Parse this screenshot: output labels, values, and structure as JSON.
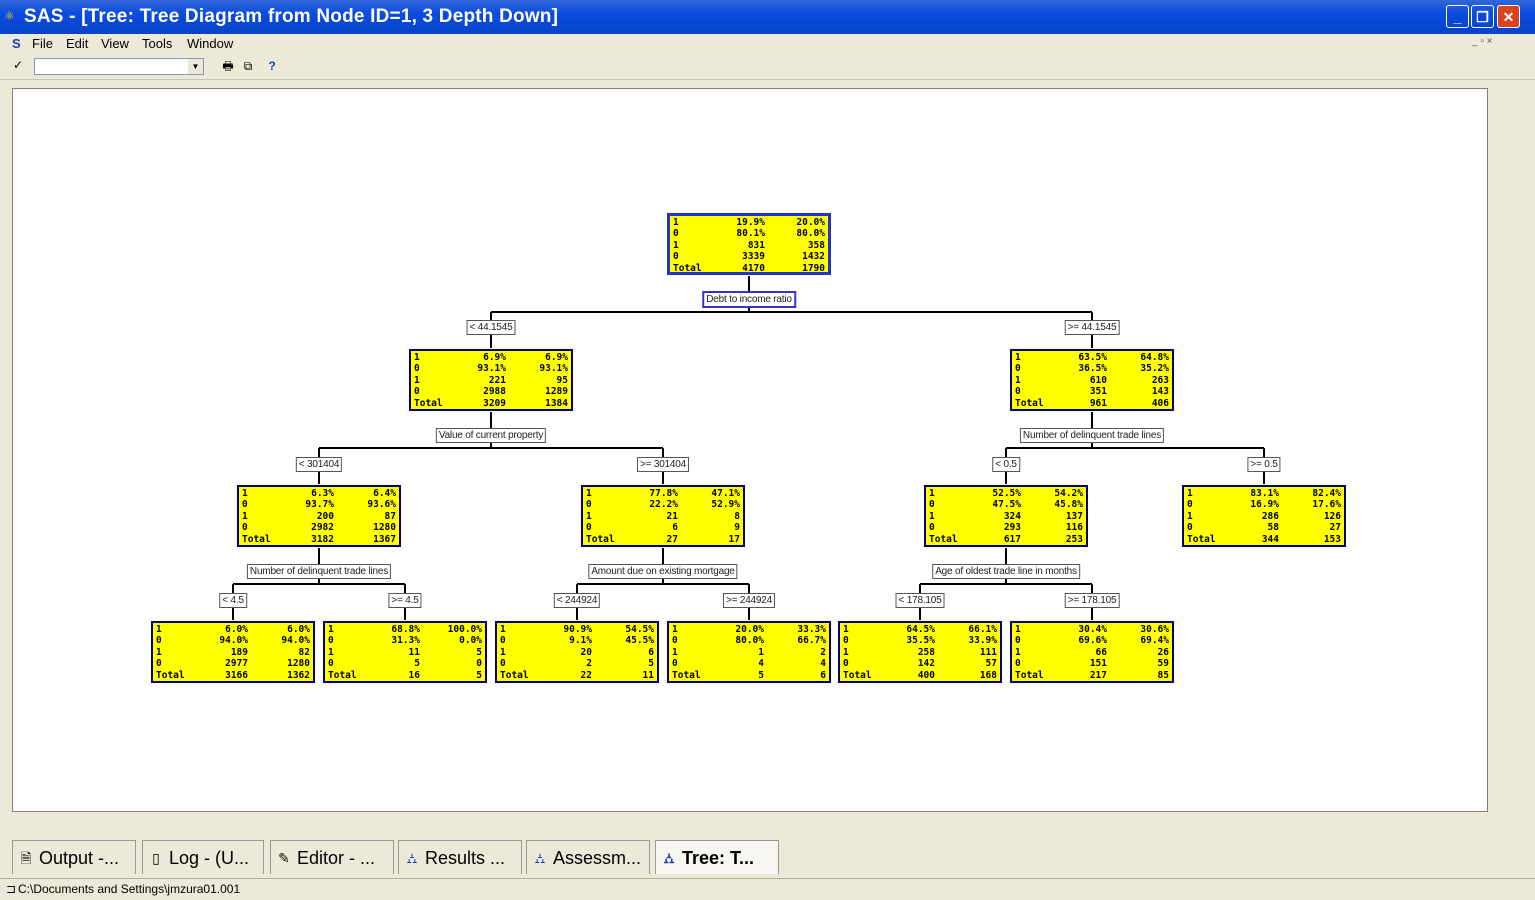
{
  "window": {
    "title": "SAS - [Tree: Tree Diagram from Node ID=1, 3 Depth Down]",
    "title_icon": "sas-icon"
  },
  "menu": {
    "items": [
      "File",
      "Edit",
      "View",
      "Tools",
      "Window"
    ]
  },
  "toolbar": {
    "check": "✓",
    "print_icon": "print-icon",
    "preview_icon": "print-preview-icon",
    "help": "?"
  },
  "tree": {
    "root": {
      "rows": [
        [
          "1",
          "19.9%",
          "20.0%"
        ],
        [
          "0",
          "80.1%",
          "80.0%"
        ],
        [
          "1",
          "831",
          "358"
        ],
        [
          "0",
          "3339",
          "1432"
        ],
        [
          "Total",
          "4170",
          "1790"
        ]
      ],
      "split": "Debt to income ratio"
    },
    "l1": {
      "branch": "< 44.1545",
      "rows": [
        [
          "1",
          "6.9%",
          "6.9%"
        ],
        [
          "0",
          "93.1%",
          "93.1%"
        ],
        [
          "1",
          "221",
          "95"
        ],
        [
          "0",
          "2988",
          "1289"
        ],
        [
          "Total",
          "3209",
          "1384"
        ]
      ],
      "split": "Value of current property"
    },
    "r1": {
      "branch": ">= 44.1545",
      "rows": [
        [
          "1",
          "63.5%",
          "64.8%"
        ],
        [
          "0",
          "36.5%",
          "35.2%"
        ],
        [
          "1",
          "610",
          "263"
        ],
        [
          "0",
          "351",
          "143"
        ],
        [
          "Total",
          "961",
          "406"
        ]
      ],
      "split": "Number of delinquent trade lines"
    },
    "ll": {
      "branch": "< 301404",
      "rows": [
        [
          "1",
          "6.3%",
          "6.4%"
        ],
        [
          "0",
          "93.7%",
          "93.6%"
        ],
        [
          "1",
          "200",
          "87"
        ],
        [
          "0",
          "2982",
          "1280"
        ],
        [
          "Total",
          "3182",
          "1367"
        ]
      ],
      "split": "Number of delinquent trade lines"
    },
    "lr": {
      "branch": ">= 301404",
      "rows": [
        [
          "1",
          "77.8%",
          "47.1%"
        ],
        [
          "0",
          "22.2%",
          "52.9%"
        ],
        [
          "1",
          "21",
          "8"
        ],
        [
          "0",
          "6",
          "9"
        ],
        [
          "Total",
          "27",
          "17"
        ]
      ],
      "split": "Amount due on existing mortgage"
    },
    "rl": {
      "branch": "< 0.5",
      "rows": [
        [
          "1",
          "52.5%",
          "54.2%"
        ],
        [
          "0",
          "47.5%",
          "45.8%"
        ],
        [
          "1",
          "324",
          "137"
        ],
        [
          "0",
          "293",
          "116"
        ],
        [
          "Total",
          "617",
          "253"
        ]
      ],
      "split": "Age of oldest trade line in months"
    },
    "rr": {
      "branch": ">= 0.5",
      "rows": [
        [
          "1",
          "83.1%",
          "82.4%"
        ],
        [
          "0",
          "16.9%",
          "17.6%"
        ],
        [
          "1",
          "286",
          "126"
        ],
        [
          "0",
          "58",
          "27"
        ],
        [
          "Total",
          "344",
          "153"
        ]
      ]
    },
    "lll": {
      "branch": "< 4.5",
      "rows": [
        [
          "1",
          "6.0%",
          "6.0%"
        ],
        [
          "0",
          "94.0%",
          "94.0%"
        ],
        [
          "1",
          "189",
          "82"
        ],
        [
          "0",
          "2977",
          "1280"
        ],
        [
          "Total",
          "3166",
          "1362"
        ]
      ]
    },
    "llr": {
      "branch": ">= 4.5",
      "rows": [
        [
          "1",
          "68.8%",
          "100.0%"
        ],
        [
          "0",
          "31.3%",
          "0.0%"
        ],
        [
          "1",
          "11",
          "5"
        ],
        [
          "0",
          "5",
          "0"
        ],
        [
          "Total",
          "16",
          "5"
        ]
      ]
    },
    "lrl": {
      "branch": "< 244924",
      "rows": [
        [
          "1",
          "90.9%",
          "54.5%"
        ],
        [
          "0",
          "9.1%",
          "45.5%"
        ],
        [
          "1",
          "20",
          "6"
        ],
        [
          "0",
          "2",
          "5"
        ],
        [
          "Total",
          "22",
          "11"
        ]
      ]
    },
    "lrr": {
      "branch": ">= 244924",
      "rows": [
        [
          "1",
          "20.0%",
          "33.3%"
        ],
        [
          "0",
          "80.0%",
          "66.7%"
        ],
        [
          "1",
          "1",
          "2"
        ],
        [
          "0",
          "4",
          "4"
        ],
        [
          "Total",
          "5",
          "6"
        ]
      ]
    },
    "rll": {
      "branch": "< 178.105",
      "rows": [
        [
          "1",
          "64.5%",
          "66.1%"
        ],
        [
          "0",
          "35.5%",
          "33.9%"
        ],
        [
          "1",
          "258",
          "111"
        ],
        [
          "0",
          "142",
          "57"
        ],
        [
          "Total",
          "400",
          "168"
        ]
      ]
    },
    "rlr": {
      "branch": ">= 178.105",
      "rows": [
        [
          "1",
          "30.4%",
          "30.6%"
        ],
        [
          "0",
          "69.6%",
          "69.4%"
        ],
        [
          "1",
          "66",
          "26"
        ],
        [
          "0",
          "151",
          "59"
        ],
        [
          "Total",
          "217",
          "85"
        ]
      ]
    }
  },
  "tabs": [
    {
      "label": "Output -...",
      "icon": "output-icon"
    },
    {
      "label": "Log - (U...",
      "icon": "log-icon"
    },
    {
      "label": "Editor - ...",
      "icon": "editor-icon"
    },
    {
      "label": "Results ...",
      "icon": "results-tree-icon"
    },
    {
      "label": "Assessm...",
      "icon": "assessment-tree-icon"
    },
    {
      "label": "Tree: T...",
      "icon": "tree-icon"
    }
  ],
  "status": {
    "path": "C:\\Documents and Settings\\jmzura01.001"
  }
}
